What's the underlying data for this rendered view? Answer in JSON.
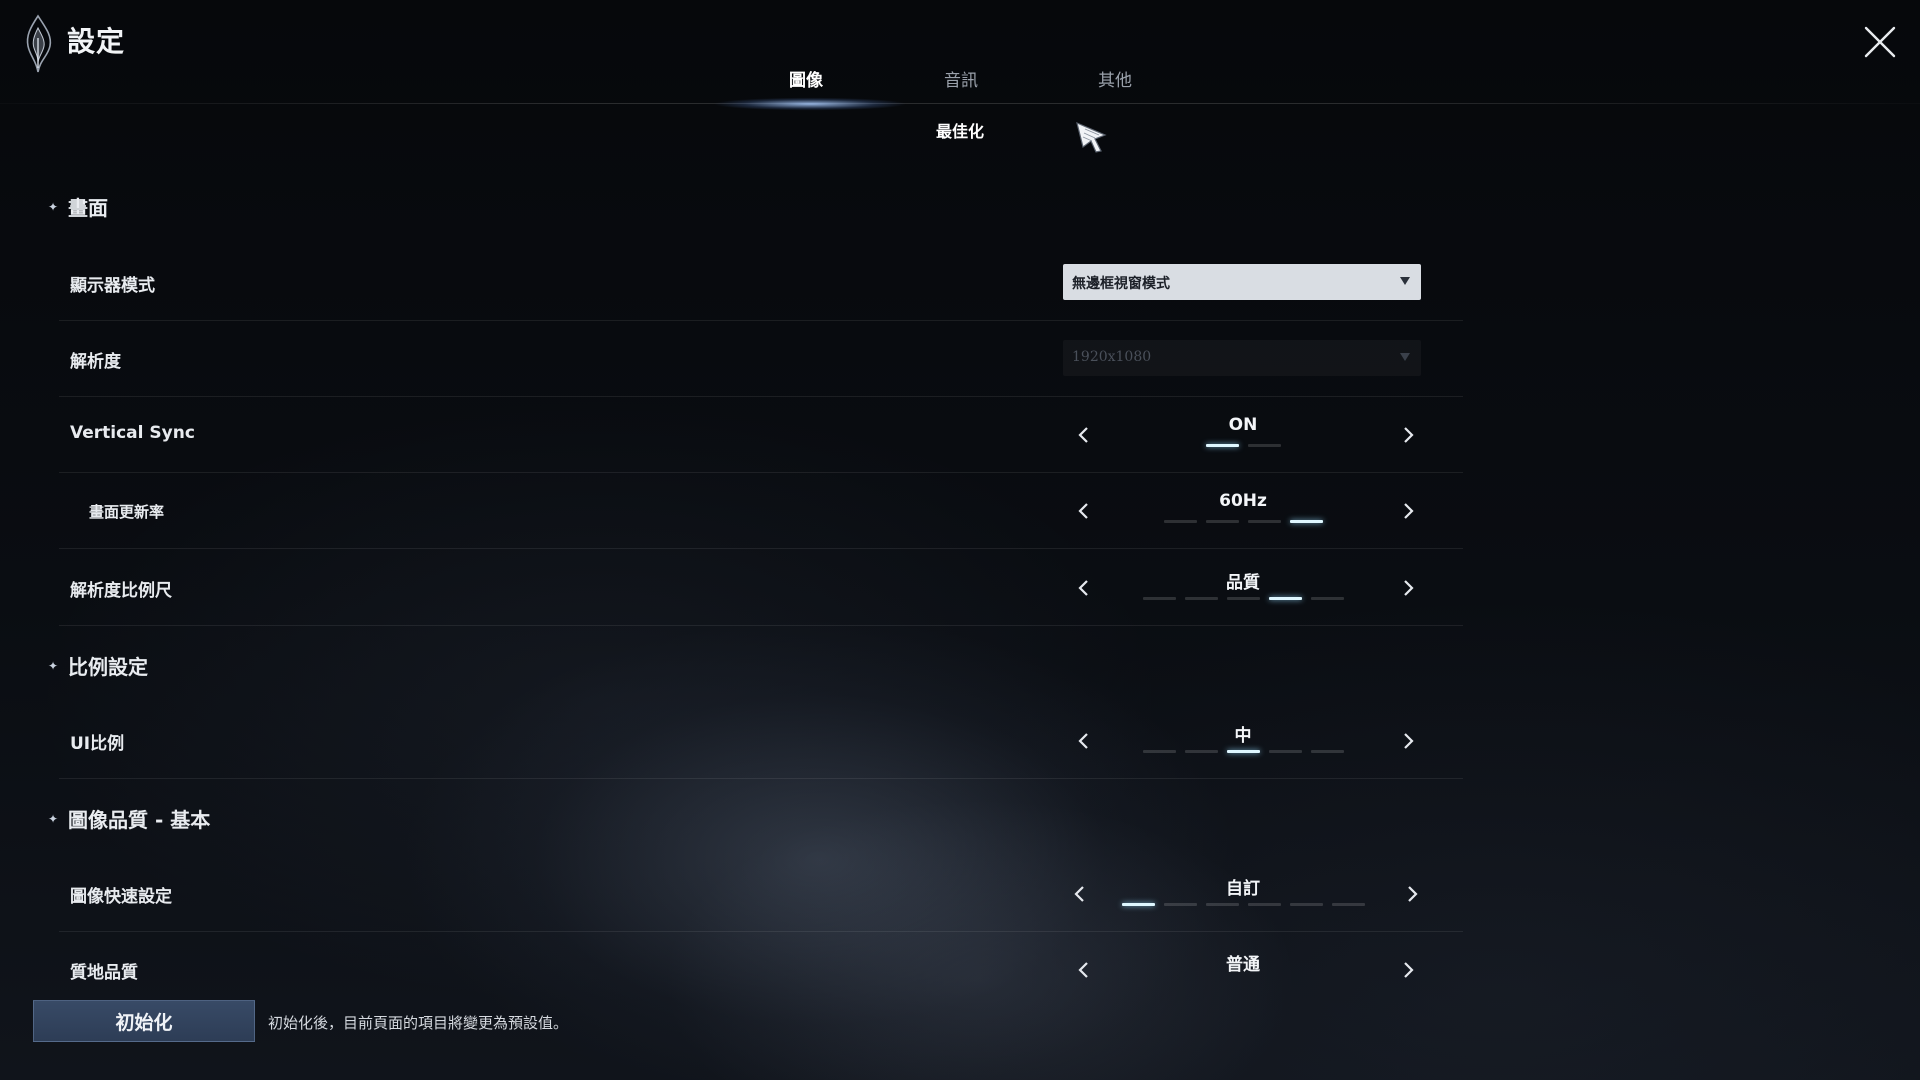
{
  "header": {
    "title": "設定",
    "logo_icon": "flame-emblem-icon",
    "close_icon": "close-icon"
  },
  "tabs": [
    {
      "label": "圖像",
      "active": true
    },
    {
      "label": "音訊",
      "active": false
    },
    {
      "label": "其他",
      "active": false
    }
  ],
  "subtab": {
    "label": "最佳化"
  },
  "sections": {
    "screen": {
      "title": "畫面"
    },
    "scale": {
      "title": "比例設定"
    },
    "quality": {
      "title": "圖像品質 - 基本"
    }
  },
  "rows": {
    "display_mode": {
      "label": "顯示器模式",
      "value": "無邊框視窗模式"
    },
    "resolution": {
      "label": "解析度",
      "value": "1920x1080",
      "disabled": true
    },
    "vsync": {
      "label": "Vertical Sync",
      "value": "ON",
      "option_count": 2,
      "selected_index": 0
    },
    "refresh_rate": {
      "label": "畫面更新率",
      "value": "60Hz",
      "option_count": 4,
      "selected_index": 3
    },
    "resolution_scale": {
      "label": "解析度比例尺",
      "value": "品質",
      "option_count": 5,
      "selected_index": 3
    },
    "ui_scale": {
      "label": "UI比例",
      "value": "中",
      "option_count": 5,
      "selected_index": 2
    },
    "quick_preset": {
      "label": "圖像快速設定",
      "value": "自訂",
      "option_count": 6,
      "selected_index": 0
    },
    "texture_quality": {
      "label": "質地品質",
      "value": "普通"
    }
  },
  "footer": {
    "reset_label": "初始化",
    "reset_note": "初始化後，目前頁面的項目將變更為預設值。"
  },
  "colors": {
    "accent_glow": "#dff7ff",
    "reset_button": "#384a66",
    "dropdown_bg": "#d9dde3"
  }
}
